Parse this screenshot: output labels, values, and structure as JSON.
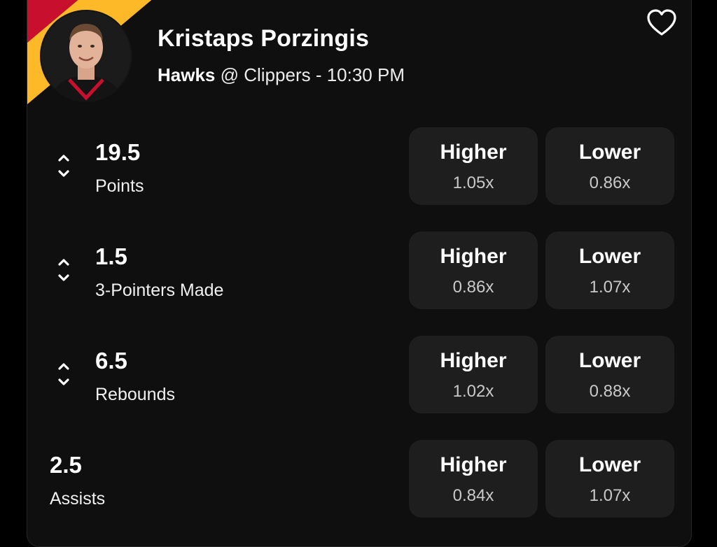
{
  "player": {
    "name": "Kristaps Porzingis",
    "team": "Hawks",
    "matchup_rest": " @ Clippers - 10:30 PM"
  },
  "colors": {
    "stripe_red": "#c8102e",
    "stripe_yellow": "#fdb927",
    "button_bg": "#1e1e1e",
    "card_bg": "#0f0f0f"
  },
  "icons": {
    "favorite": "heart-outline-icon",
    "increase": "chevron-up-icon",
    "decrease": "chevron-down-icon"
  },
  "props": [
    {
      "line": "19.5",
      "stat": "Points",
      "has_arrows": true,
      "higher_label": "Higher",
      "higher_mult": "1.05x",
      "lower_label": "Lower",
      "lower_mult": "0.86x"
    },
    {
      "line": "1.5",
      "stat": "3-Pointers Made",
      "has_arrows": true,
      "higher_label": "Higher",
      "higher_mult": "0.86x",
      "lower_label": "Lower",
      "lower_mult": "1.07x"
    },
    {
      "line": "6.5",
      "stat": "Rebounds",
      "has_arrows": true,
      "higher_label": "Higher",
      "higher_mult": "1.02x",
      "lower_label": "Lower",
      "lower_mult": "0.88x"
    },
    {
      "line": "2.5",
      "stat": "Assists",
      "has_arrows": false,
      "higher_label": "Higher",
      "higher_mult": "0.84x",
      "lower_label": "Lower",
      "lower_mult": "1.07x"
    }
  ]
}
